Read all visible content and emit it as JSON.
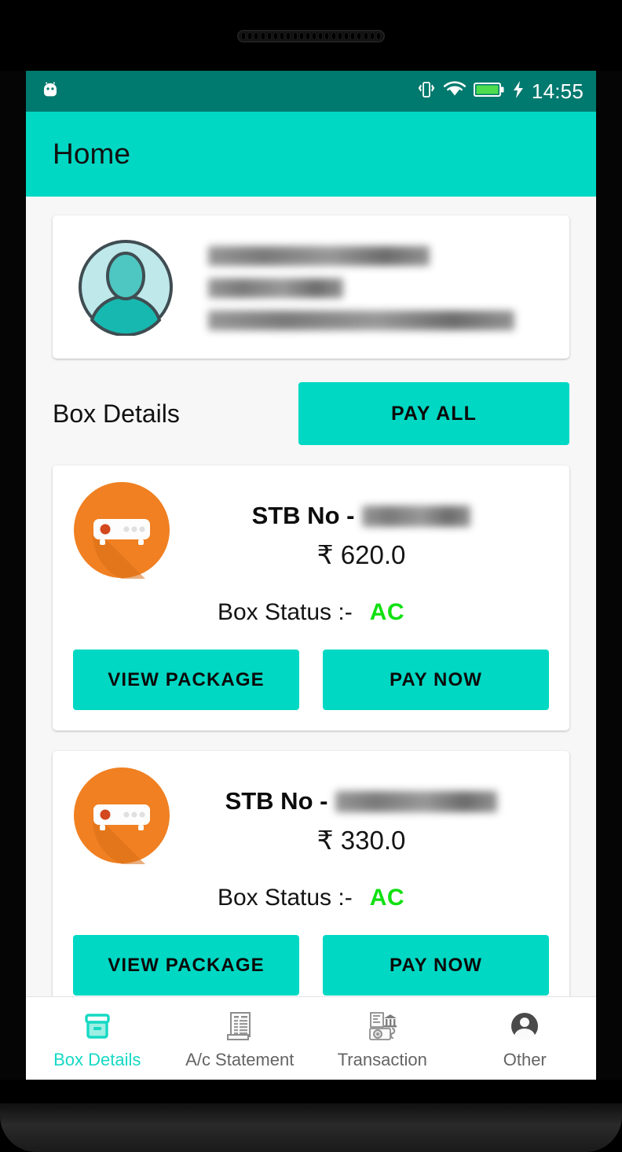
{
  "device": {
    "speaker_holes": 22
  },
  "status_bar": {
    "time": "14:55",
    "icons": [
      "android-robot-icon",
      "vibrate-icon",
      "wifi-icon",
      "battery-full-icon",
      "charging-bolt-icon"
    ],
    "background_color": "#00796e"
  },
  "app_bar": {
    "title": "Home",
    "background_color": "#00d8c3"
  },
  "profile": {
    "avatar_icon": "user-avatar-icon",
    "name_line_1": "",
    "name_line_2": "",
    "address_line": "",
    "redacted": true
  },
  "section": {
    "title": "Box Details",
    "pay_all_label": "PAY ALL"
  },
  "boxes": [
    {
      "icon": "set-top-box-icon",
      "stb_label": "STB No - ",
      "stb_number": "",
      "amount": "₹ 620.0",
      "status_label": "Box Status :-",
      "status_value": "AC",
      "status_color": "#11e011",
      "view_package_label": "VIEW PACKAGE",
      "pay_now_label": "PAY NOW"
    },
    {
      "icon": "set-top-box-icon",
      "stb_label": "STB No - ",
      "stb_number": "",
      "amount": "₹ 330.0",
      "status_label": "Box Status :-",
      "status_value": "AC",
      "status_color": "#11e011",
      "view_package_label": "VIEW PACKAGE",
      "pay_now_label": "PAY NOW"
    }
  ],
  "bottom_nav": {
    "active_index": 0,
    "active_color": "#16d9c4",
    "inactive_color": "#646464",
    "items": [
      {
        "label": "Box Details",
        "icon": "box-archive-icon"
      },
      {
        "label": "A/c Statement",
        "icon": "document-statement-icon"
      },
      {
        "label": "Transaction",
        "icon": "bank-transaction-icon"
      },
      {
        "label": "Other",
        "icon": "account-circle-icon"
      }
    ]
  }
}
